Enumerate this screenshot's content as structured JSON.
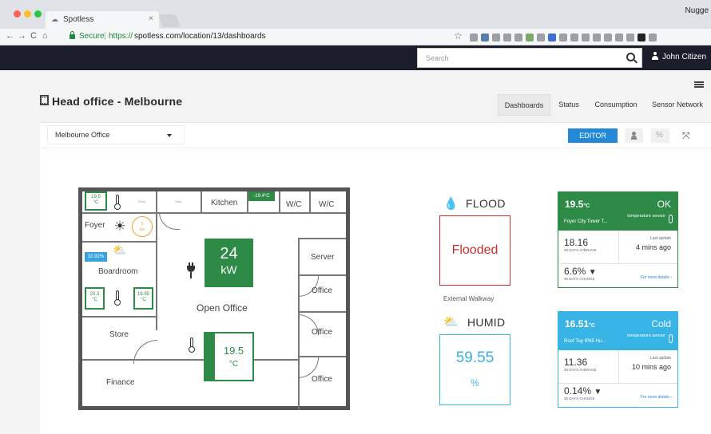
{
  "browser": {
    "tab_title": "Spotless",
    "tab_close": "×",
    "profile": "Nugge",
    "back": "←",
    "forward": "→",
    "reload": "C",
    "home": "⌂",
    "secure_label": "Secure",
    "url_scheme": "https://",
    "url_rest": "spotless.com/location/13/dashboards",
    "star": "☆"
  },
  "header": {
    "search_placeholder": "Search",
    "user_name": "John Citizen"
  },
  "page": {
    "title": "Head office - Melbourne",
    "tabs": [
      "Dashboards",
      "Status",
      "Consumption",
      "Sensor Network"
    ]
  },
  "toolbar": {
    "location_select": "Melbourne Office",
    "editor_label": "EDITOR",
    "link_icon": "%",
    "expand_icon": "⤧"
  },
  "floorplan": {
    "rooms": {
      "kitchen": "Kitchen",
      "wc1": "W/C",
      "wc2": "W/C",
      "foyer": "Foyer",
      "boardroom": "Boardroom",
      "server": "Server",
      "office1": "Office",
      "office2": "Office",
      "office3": "Office",
      "open_office": "Open Office",
      "store": "Store",
      "finance": "Finance"
    },
    "tiny_labels": {
      "a": "Entry",
      "b": "Stair"
    },
    "kitchen_temp": "-19.4°C",
    "foyer_temp": "19.5",
    "foyer_temp_unit": "°C",
    "foyer_ring": "0",
    "foyer_ring_unit": "lux",
    "boardroom_humid": "32.92%",
    "boardroom_t1": "20.3",
    "boardroom_t1_unit": "°C",
    "boardroom_t2": "19.95",
    "boardroom_t2_unit": "°C",
    "power_value": "24",
    "power_unit": "kW",
    "open_temp": "19.5",
    "open_temp_unit": "°C"
  },
  "widgets": {
    "flood": {
      "title": "FLOOD",
      "value": "Flooded",
      "caption": "External Walkway"
    },
    "humid": {
      "title": "HUMID",
      "value": "59.55",
      "unit": "%"
    },
    "cards": [
      {
        "temp": "19.5",
        "unit": "°C",
        "status": "OK",
        "name": "Foyer City Tower T...",
        "type": "temperature sensor",
        "avg": "18.16",
        "avg_label": "30 DAYS AVERAGE",
        "update_label": "Last update",
        "update": "4 mins ago",
        "change": "6.6%",
        "change_arrow": "▼",
        "change_label": "30 DAYS CHANGE",
        "more": "For more details ›",
        "color": "#2e8b47"
      },
      {
        "temp": "16.51",
        "unit": "°C",
        "status": "Cold",
        "name": "Roof Top IP65 Hu...",
        "type": "temperature sensor",
        "avg": "11.36",
        "avg_label": "30 DAYS AVERAGE",
        "update_label": "Last update",
        "update": "10 mins ago",
        "change": "0.14%",
        "change_arrow": "▼",
        "change_label": "30 DAYS CHANGE",
        "more": "For more details ›",
        "color": "#38b3e6"
      }
    ]
  }
}
